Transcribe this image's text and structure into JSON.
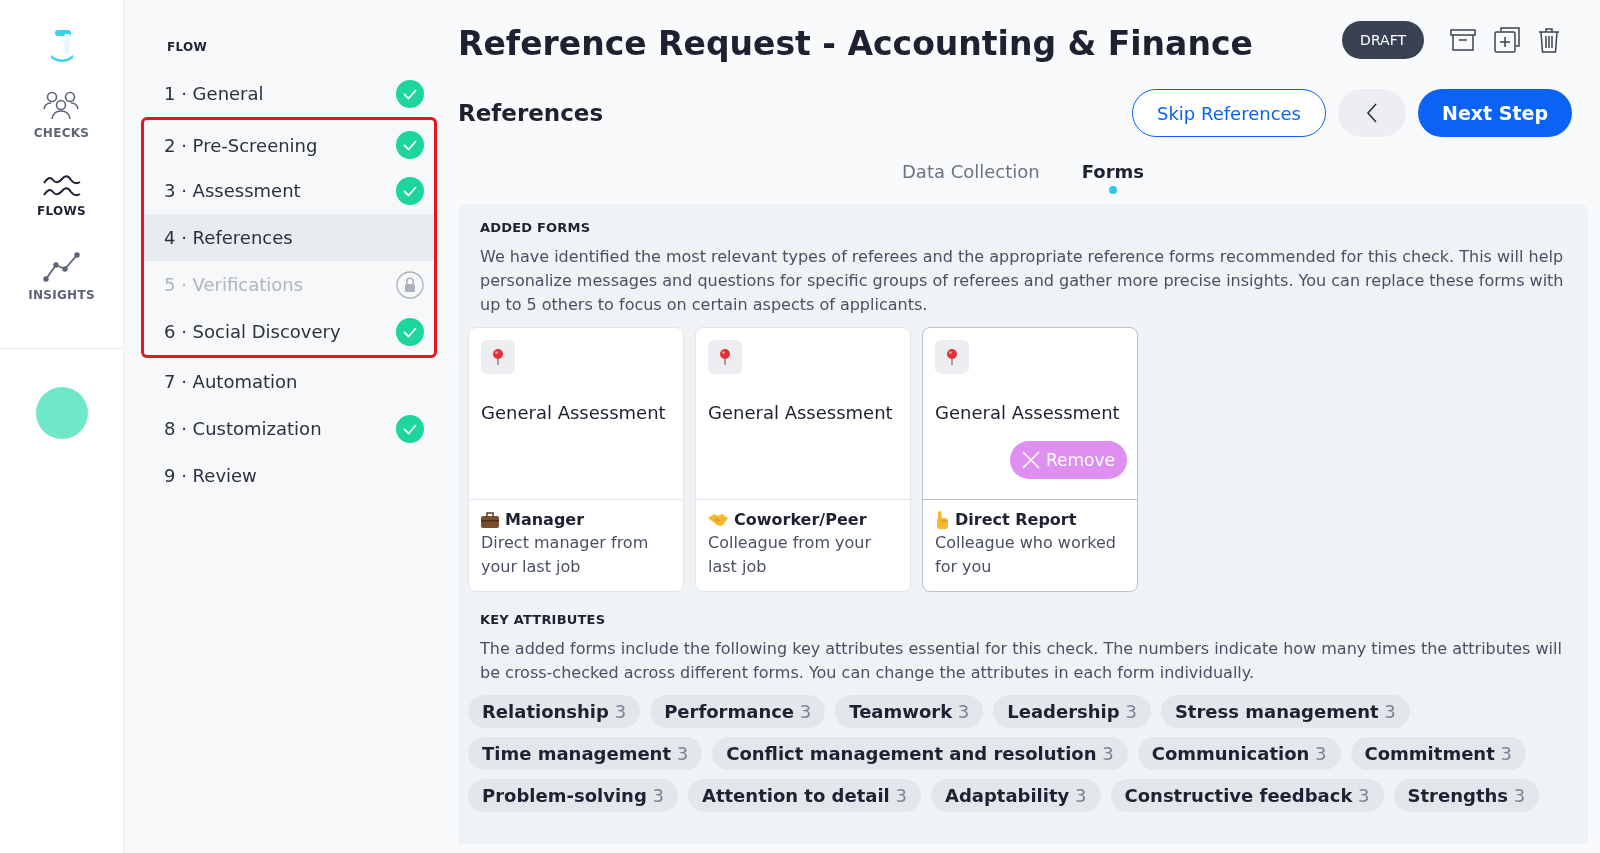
{
  "nav": {
    "items": [
      {
        "label": "CHECKS",
        "kind": "people",
        "selected": false
      },
      {
        "label": "FLOWS",
        "kind": "waves",
        "selected": true
      },
      {
        "label": "INSIGHTS",
        "kind": "chart",
        "selected": false
      }
    ]
  },
  "flow": {
    "heading": "FLOW",
    "items": [
      {
        "label": "1 · General",
        "completed": true,
        "locked": false,
        "selected": false,
        "highlighted": false
      },
      {
        "label": "2 · Pre-Screening",
        "completed": true,
        "locked": false,
        "selected": false,
        "highlighted": true
      },
      {
        "label": "3 · Assessment",
        "completed": true,
        "locked": false,
        "selected": false,
        "highlighted": true
      },
      {
        "label": "4 · References",
        "completed": false,
        "locked": false,
        "selected": true,
        "highlighted": true
      },
      {
        "label": "5 · Verifications",
        "completed": false,
        "locked": true,
        "selected": false,
        "highlighted": true
      },
      {
        "label": "6 · Social Discovery",
        "completed": true,
        "locked": false,
        "selected": false,
        "highlighted": true
      },
      {
        "label": "7 · Automation",
        "completed": false,
        "locked": false,
        "selected": false,
        "highlighted": false
      },
      {
        "label": "8 · Customization",
        "completed": true,
        "locked": false,
        "selected": false,
        "highlighted": false
      },
      {
        "label": "9 · Review",
        "completed": false,
        "locked": false,
        "selected": false,
        "highlighted": false
      }
    ]
  },
  "header": {
    "title": "Reference Request - Accounting & Finance",
    "status_badge": "DRAFT",
    "section_title": "References",
    "skip_button": "Skip References",
    "next_button": "Next Step"
  },
  "tabs": [
    {
      "label": "Data Collection",
      "selected": false
    },
    {
      "label": "Forms",
      "selected": true
    }
  ],
  "added_forms": {
    "heading": "ADDED FORMS",
    "description": "We have identified the most relevant types of referees and the appropriate reference forms recommended for this check. This will help personalize messages and questions for specific groups of referees and gather more precise insights. You can replace these forms with up to 5 others to focus on certain aspects of applicants.",
    "cards": [
      {
        "form": "General Assessment",
        "role": "Manager",
        "kind": "briefcase",
        "role_description": "Direct manager from your last job"
      },
      {
        "form": "General Assessment",
        "role": "Coworker/Peer",
        "kind": "handshake",
        "role_description": "Colleague from your last job"
      },
      {
        "form": "General Assessment",
        "role": "Direct Report",
        "kind": "pointing",
        "role_description": "Colleague who worked for you",
        "remove_button": "Remove"
      }
    ]
  },
  "key_attributes": {
    "heading": "KEY ATTRIBUTES",
    "description": "The added forms include the following key attributes essential for this check. The numbers indicate how many times the attributes will be cross-checked across different forms. You can change the attributes in each form individually.",
    "tags": [
      {
        "name": "Relationship",
        "count": "3"
      },
      {
        "name": "Performance",
        "count": "3"
      },
      {
        "name": "Teamwork",
        "count": "3"
      },
      {
        "name": "Leadership",
        "count": "3"
      },
      {
        "name": "Stress management",
        "count": "3"
      },
      {
        "name": "Time management",
        "count": "3"
      },
      {
        "name": "Conflict management and resolution",
        "count": "3"
      },
      {
        "name": "Communication",
        "count": "3"
      },
      {
        "name": "Commitment",
        "count": "3"
      },
      {
        "name": "Problem-solving",
        "count": "3"
      },
      {
        "name": "Attention to detail",
        "count": "3"
      },
      {
        "name": "Adaptability",
        "count": "3"
      },
      {
        "name": "Constructive feedback",
        "count": "3"
      },
      {
        "name": "Strengths",
        "count": "3"
      }
    ]
  }
}
